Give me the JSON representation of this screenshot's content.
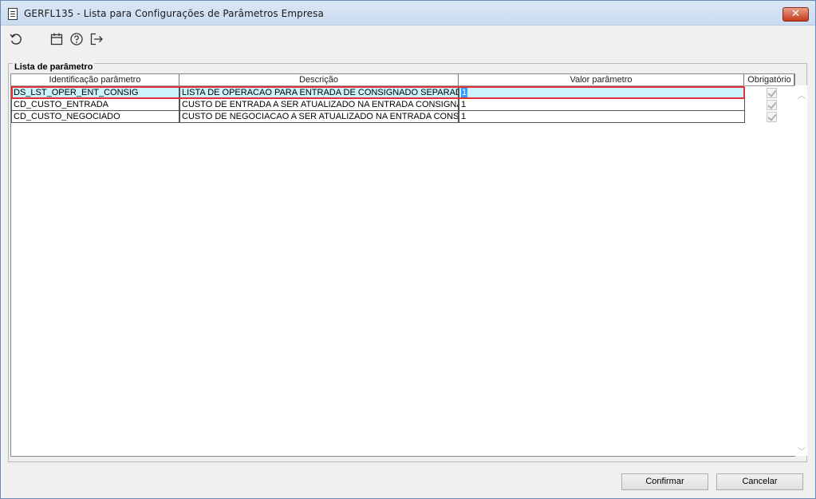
{
  "window": {
    "title": "GERFL135 - Lista para Configurações de Parâmetros Empresa",
    "close_label": "✕"
  },
  "toolbar": {
    "icons": [
      "refresh-icon",
      "calendar-icon",
      "help-icon",
      "exit-icon"
    ]
  },
  "panel": {
    "legend": "Lista de parâmetro"
  },
  "table": {
    "columns": [
      "Identificação parâmetro",
      "Descrição",
      "Valor parâmetro",
      "Obrigatório"
    ],
    "rows": [
      {
        "id": "DS_LST_OPER_ENT_CONSIG",
        "descricao": "LISTA DE OPERACAO PARA ENTRADA DE CONSIGNADO SEPARADA PC",
        "valor": "1",
        "obrigatorio": true,
        "selected": true
      },
      {
        "id": "CD_CUSTO_ENTRADA",
        "descricao": "CUSTO DE ENTRADA A SER ATUALIZADO NA ENTRADA CONSIGNACAO",
        "valor": "1",
        "obrigatorio": true,
        "selected": false
      },
      {
        "id": "CD_CUSTO_NEGOCIADO",
        "descricao": "CUSTO DE NEGOCIACAO A SER ATUALIZADO NA ENTRADA CONSIGNA",
        "valor": "1",
        "obrigatorio": true,
        "selected": false
      }
    ]
  },
  "buttons": {
    "confirm": "Confirmar",
    "cancel": "Cancelar"
  },
  "colors": {
    "selected_row": "#ccf2fc",
    "selection_outline": "#e0303a",
    "close_button": "#c43a1b"
  }
}
